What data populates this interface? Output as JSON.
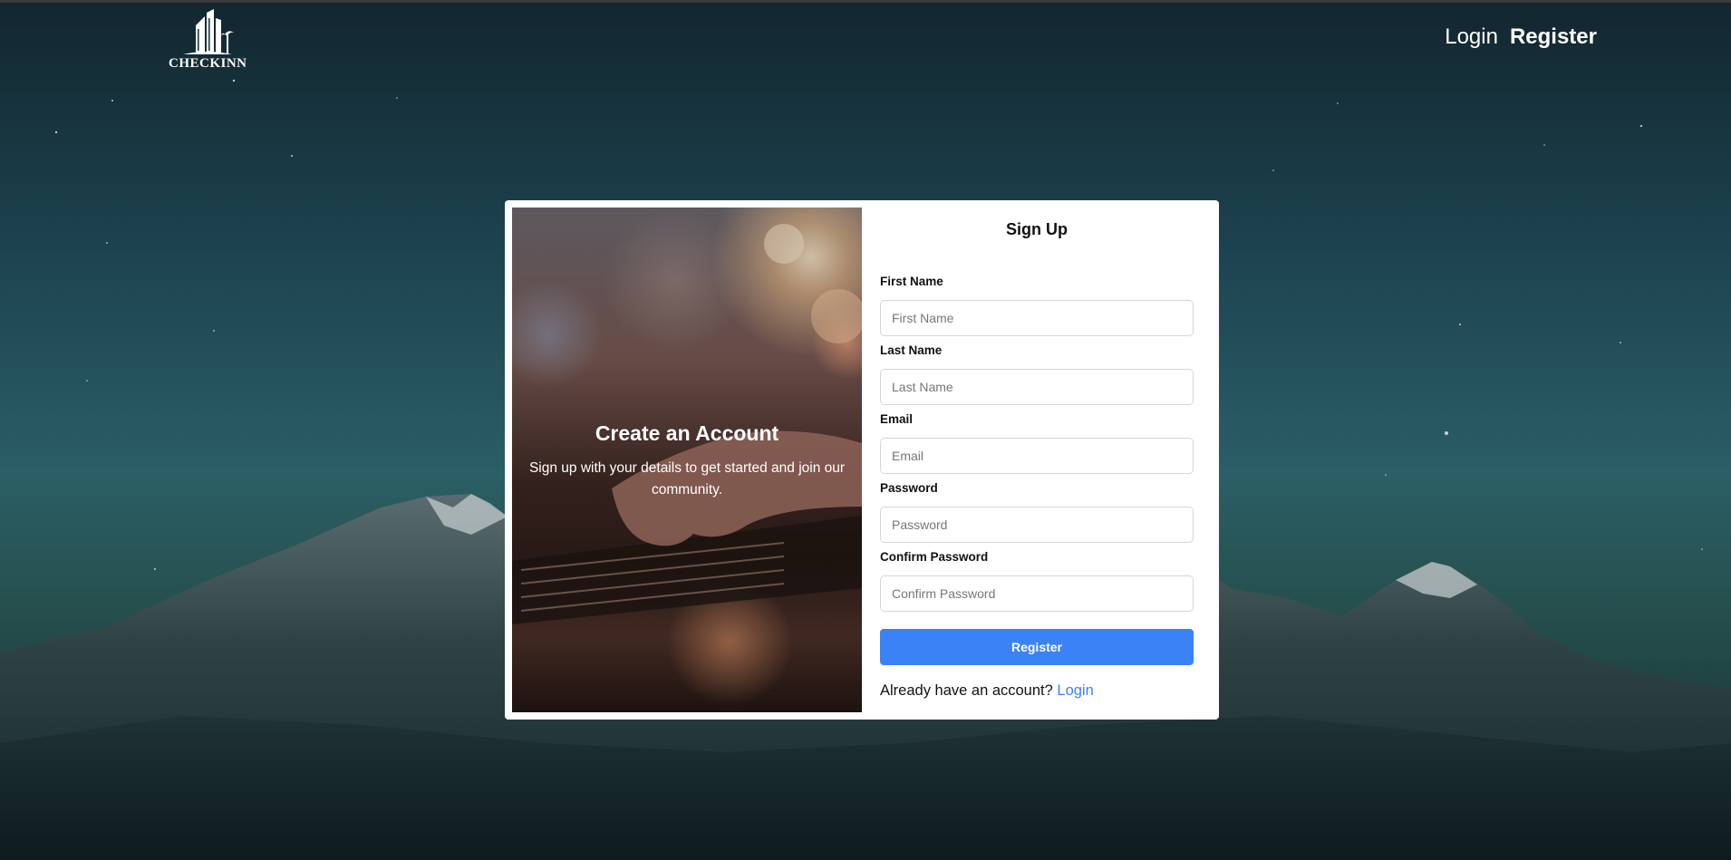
{
  "header": {
    "logo_text": "CHECKINN",
    "nav": {
      "login_label": "Login",
      "register_label": "Register"
    }
  },
  "hero": {
    "title": "Create an Account",
    "subtitle": "Sign up with your details to get started and join our community."
  },
  "form": {
    "title": "Sign Up",
    "fields": [
      {
        "label": "First Name",
        "placeholder": "First Name",
        "value": ""
      },
      {
        "label": "Last Name",
        "placeholder": "Last Name",
        "value": ""
      },
      {
        "label": "Email",
        "placeholder": "Email",
        "value": ""
      },
      {
        "label": "Password",
        "placeholder": "Password",
        "value": ""
      },
      {
        "label": "Confirm Password",
        "placeholder": "Confirm Password",
        "value": ""
      }
    ],
    "submit_label": "Register",
    "footer_text": "Already have an account?",
    "footer_link": "Login"
  },
  "colors": {
    "accent": "#3b82f6",
    "card_bg": "#ffffff",
    "sky_dark": "#12262f",
    "sky_light": "#2b5e66"
  },
  "icons": {
    "logo": "building-icon"
  }
}
